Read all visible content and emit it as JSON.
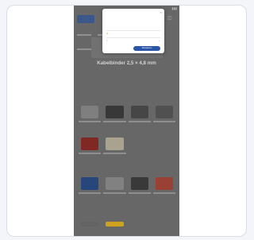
{
  "page": {
    "product_title": "Kabelbinder 2,5 × 4,8 mm"
  },
  "cookie_modal": {
    "accept_label": "Akzeptieren"
  },
  "icons": [
    "signal-icon",
    "menu-icon",
    "search-icon",
    "cart-icon",
    "close-icon",
    "chevron-down-icon"
  ],
  "colors": {
    "brand": "#2b56a8",
    "accent_red": "#c23b2f",
    "accent_yellow": "#e3b21d",
    "overlay": "#6f6f6f"
  }
}
